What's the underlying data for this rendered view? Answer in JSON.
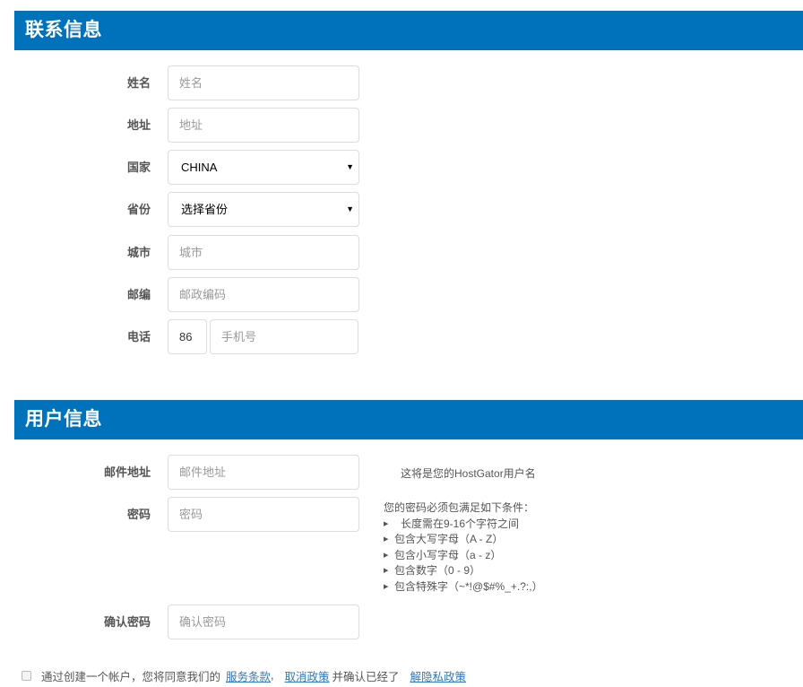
{
  "contact": {
    "title": "联系信息",
    "fields": {
      "name": {
        "label": "姓名",
        "placeholder": "姓名",
        "value": ""
      },
      "address": {
        "label": "地址",
        "placeholder": "地址",
        "value": ""
      },
      "country": {
        "label": "国家",
        "selected": "CHINA"
      },
      "province": {
        "label": "省份",
        "selected": "选择省份"
      },
      "city": {
        "label": "城市",
        "placeholder": "城市",
        "value": ""
      },
      "zip": {
        "label": "邮编",
        "placeholder": "邮政编码",
        "value": ""
      },
      "phone": {
        "label": "电话",
        "country_code": "86",
        "placeholder": "手机号",
        "value": ""
      }
    }
  },
  "user": {
    "title": "用户信息",
    "fields": {
      "email": {
        "label": "邮件地址",
        "placeholder": "邮件地址",
        "value": "",
        "hint": "这将是您的HostGator用户名"
      },
      "password": {
        "label": "密码",
        "placeholder": "密码",
        "value": ""
      },
      "confirm_password": {
        "label": "确认密码",
        "placeholder": "确认密码",
        "value": ""
      }
    },
    "password_rules": {
      "title": "您的密码必须包满足如下条件：",
      "items": [
        "长度需在9-16个字符之间",
        "包含大写字母（A - Z）",
        "包含小写字母（a - z）",
        "包含数字（0 - 9）",
        "包含特殊字（~*!@$#%_+.?:,）"
      ]
    }
  },
  "terms": {
    "checked": false,
    "text_before": "通过创建一个帐户，您将同意我们的",
    "link_terms": "服务条款",
    "separator": ",",
    "link_cancel": "取消政策",
    "text_middle": "并确认已经了",
    "link_privacy": "解隐私政策"
  },
  "colors": {
    "header_bg": "#0072bc",
    "link": "#337ab7"
  }
}
